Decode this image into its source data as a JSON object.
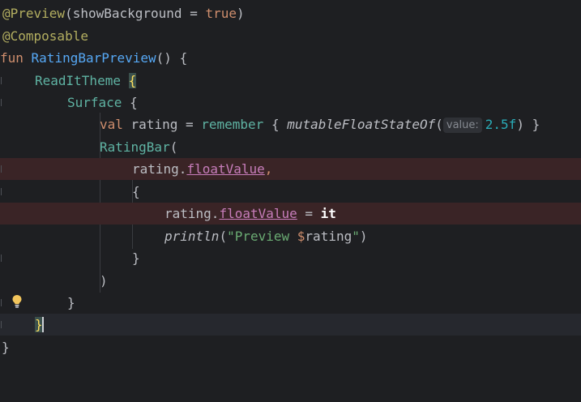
{
  "lines": {
    "l1": {
      "anno": "@Preview",
      "open": "(",
      "param": "showBackground",
      "eq": " = ",
      "val": "true",
      "close": ")"
    },
    "l2": {
      "anno": "@Composable"
    },
    "l3": {
      "kw": "fun",
      "name": " RatingBarPreview",
      "rest": "() {"
    },
    "l4": {
      "name": "ReadItTheme",
      "brace": "{"
    },
    "l5": {
      "name": "Surface",
      "brace": " {"
    },
    "l6": {
      "kw": "val",
      "var": " rating",
      "eq": " = ",
      "fn": "remember",
      "open": " { ",
      "call": "mutableFloatStateOf",
      "paren": "(",
      "hint": "value:",
      "num": "2.5f",
      "close": ") }"
    },
    "l7": {
      "name": "RatingBar",
      "open": "("
    },
    "l8": {
      "obj": "rating.",
      "prop": "floatValue",
      "comma": ","
    },
    "l9": {
      "brace": "{"
    },
    "l10": {
      "obj": "rating.",
      "prop": "floatValue",
      "eq": " = ",
      "it": "it"
    },
    "l11": {
      "fn": "println",
      "open": "(",
      "str1": "\"Preview ",
      "tpl": "$",
      "str2": "rating",
      "str3": "\"",
      "close": ")"
    },
    "l12": {
      "brace": "}"
    },
    "l13": {
      "paren": ")"
    },
    "l14": {
      "brace": "}"
    },
    "l15": {
      "brace": "}"
    },
    "l16": {
      "brace": "}"
    }
  },
  "icons": {
    "bulb": "lightbulb-icon"
  }
}
